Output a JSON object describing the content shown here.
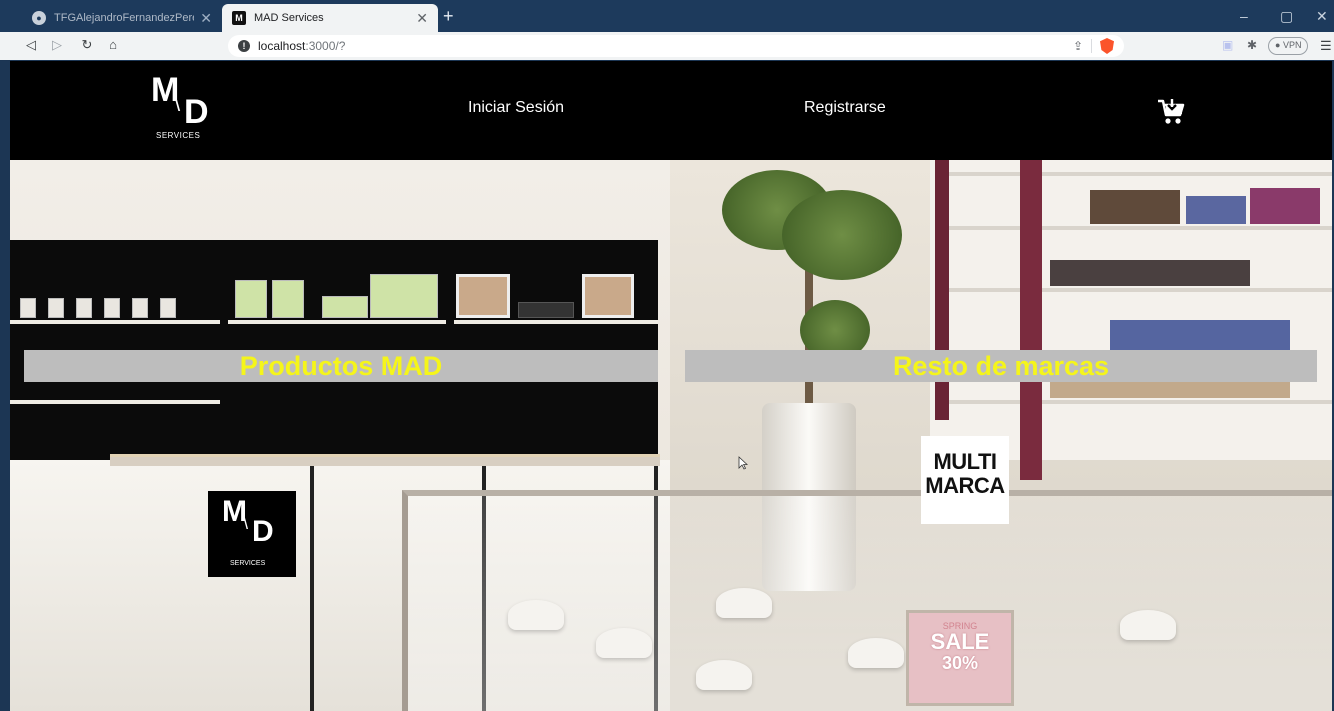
{
  "browser": {
    "tabs": [
      {
        "title": "TFGAlejandroFernandezPerez.pdf",
        "active": false
      },
      {
        "title": "MAD Services",
        "active": true
      }
    ],
    "new_tab_label": "+",
    "address": {
      "host": "localhost",
      "path": ":3000/?"
    },
    "vpn_label": "VPN",
    "window_controls": {
      "minimize": "–",
      "restore": "▢",
      "close": "✕"
    }
  },
  "site": {
    "logo": {
      "m": "M",
      "slash": "\\",
      "d": "D",
      "services": "SERVICES"
    },
    "nav": {
      "login": "Iniciar Sesión",
      "register": "Registrarse"
    },
    "cart_icon": "cart-add-icon"
  },
  "categories": {
    "mad": {
      "label": "Productos MAD"
    },
    "other": {
      "label": "Resto de marcas"
    }
  },
  "cards": {
    "mad": {
      "m": "M",
      "slash": "\\",
      "d": "D",
      "services": "SERVICES"
    },
    "multi": {
      "line1": "MULTI",
      "line2": "MARCA"
    }
  },
  "scene": {
    "sale_sign": {
      "line1": "SPRING",
      "line2": "SALE",
      "line3": "30%"
    }
  },
  "colors": {
    "banner_text": "#f5f51a",
    "banner_bg": "#bdbdbd",
    "header_bg": "#000000"
  }
}
